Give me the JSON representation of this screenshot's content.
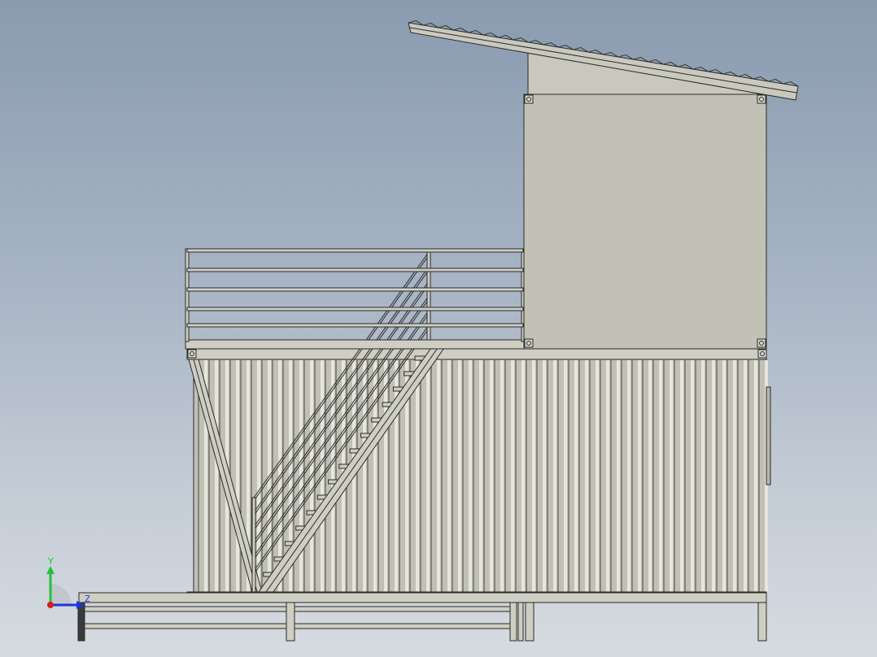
{
  "viewport": {
    "background_top": "#8a9bb0",
    "background_bottom": "#d6dbe0"
  },
  "model": {
    "view": "front",
    "body_color": "#c4c3b7",
    "edge_color": "#2a2a2a",
    "components": [
      "corrugated-roof",
      "upper-cabin",
      "platform-railing",
      "container-lower-level",
      "diagonal-stair",
      "ground-deck-fence"
    ]
  },
  "triad": {
    "y_label": "Y",
    "z_label": "Z",
    "y_color": "#22c23a",
    "z_color": "#2233dd",
    "x_color": "#d42020"
  }
}
